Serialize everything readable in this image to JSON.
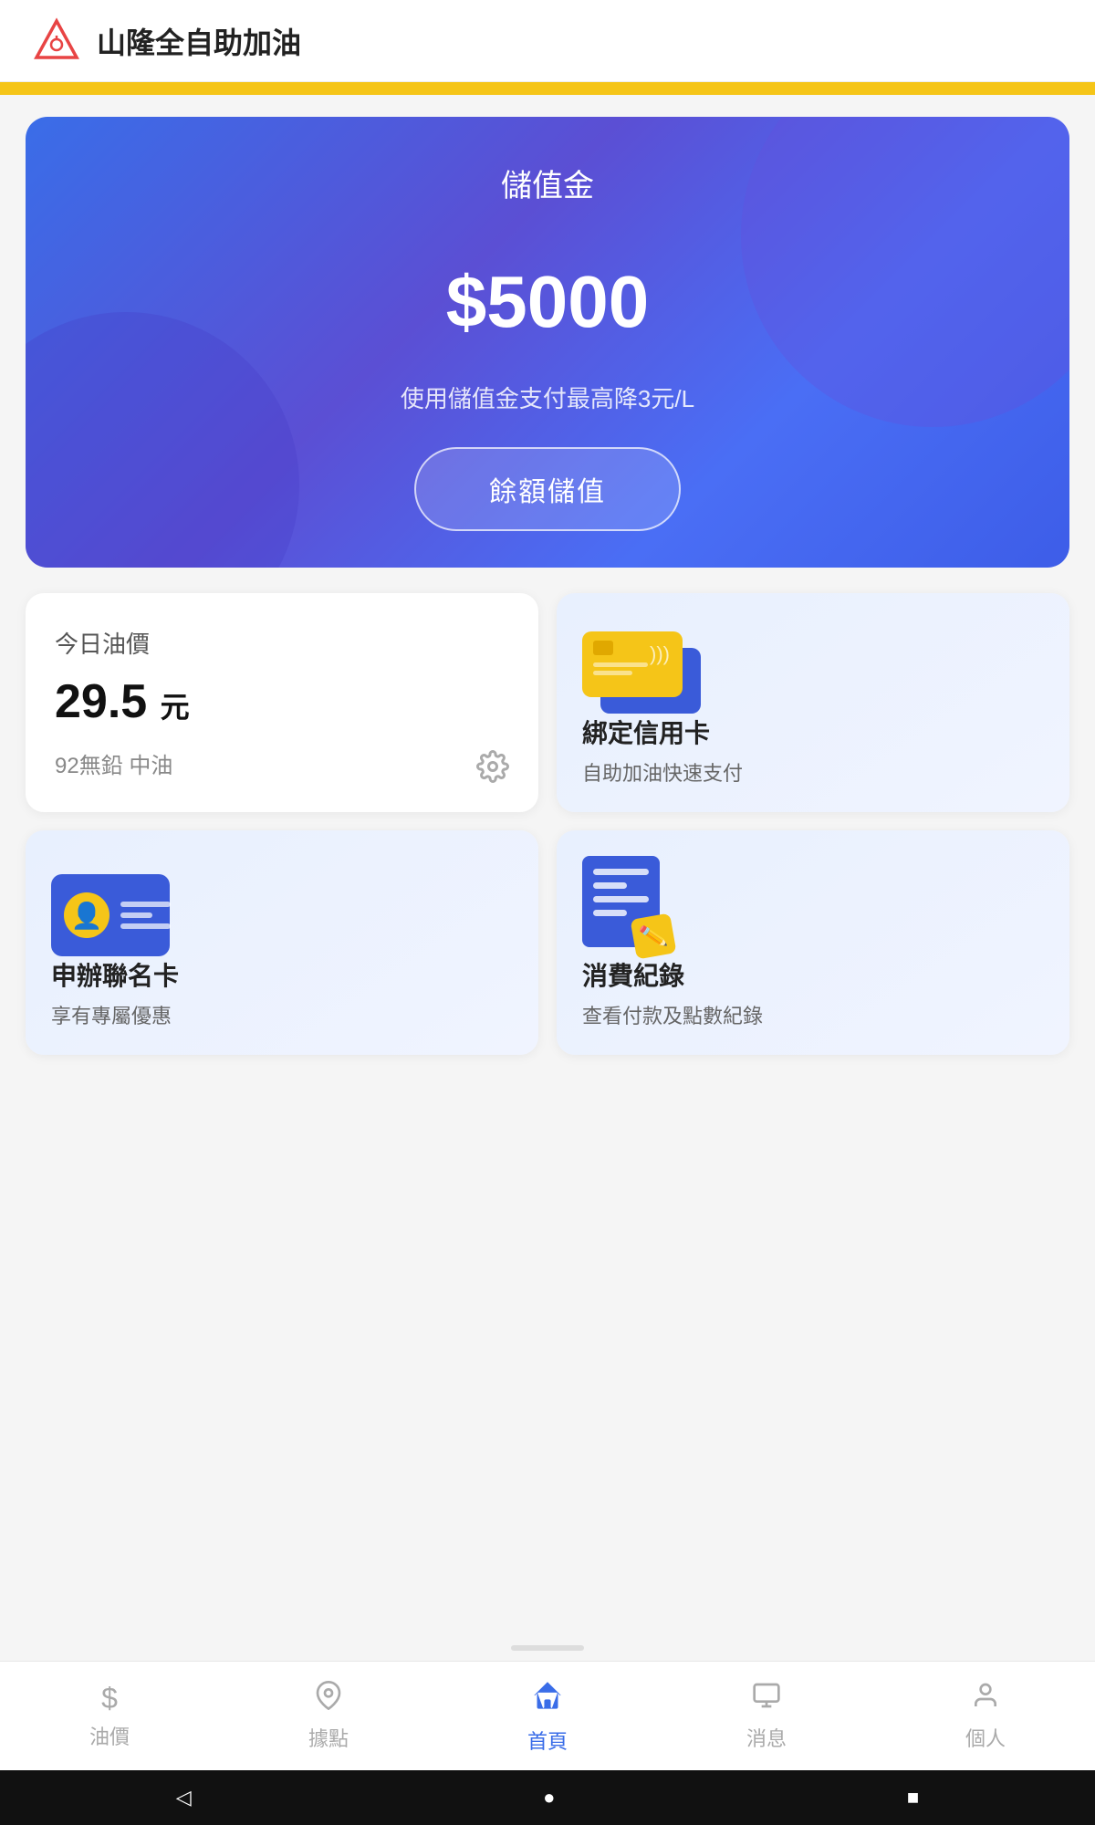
{
  "header": {
    "title": "山隆全自助加油",
    "icon_label": "logo-icon"
  },
  "balance_card": {
    "label": "儲值金",
    "amount": "$5000",
    "hint": "使用儲值金支付最高降3元/L",
    "button_label": "餘額儲值"
  },
  "oil_price": {
    "title": "今日油價",
    "value": "29.5",
    "unit": "元",
    "description": "92無鉛 中油"
  },
  "credit_card": {
    "title": "綁定信用卡",
    "subtitle": "自助加油快速支付"
  },
  "membership_card": {
    "title": "申辦聯名卡",
    "subtitle": "享有專屬優惠"
  },
  "records": {
    "title": "消費紀錄",
    "subtitle": "查看付款及點數紀錄"
  },
  "bottom_nav": {
    "items": [
      {
        "label": "油價",
        "icon": "$"
      },
      {
        "label": "據點",
        "icon": "♟"
      },
      {
        "label": "首頁",
        "icon": "⌂"
      },
      {
        "label": "消息",
        "icon": "☰"
      },
      {
        "label": "個人",
        "icon": "👤"
      }
    ],
    "active_index": 2
  },
  "system_bar": {
    "back": "◁",
    "home": "●",
    "recent": "■"
  }
}
